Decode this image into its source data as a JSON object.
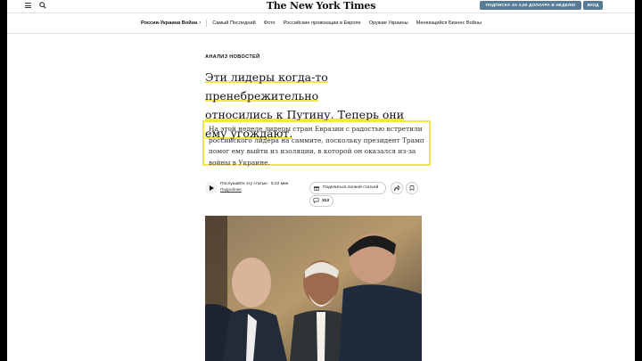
{
  "header": {
    "logo": "The New York Times",
    "subscribe_label": "ПОДПИСКА ЗА 0,50 ДОЛЛАРА В НЕДЕЛЮ",
    "login_label": "ВХОД"
  },
  "nav": {
    "main": "Россия-Украина Война",
    "items": [
      "Самый Последний",
      "Фото",
      "Российские провокации в Европе",
      "Оружие Украины",
      "Меняющийся Бизнес Войны"
    ]
  },
  "article": {
    "kicker": "АНАЛИЗ НОВОСТЕЙ",
    "headline_lines": [
      "Эти лидеры когда-то пренебрежительно",
      "относились к Путину. Теперь они",
      "ему угождают."
    ],
    "summary": "На этой неделе лидеры стран Евразии с радостью встретили российского лидера на саммите, поскольку президент Трамп помог ему выйти из изоляции, в которой он оказался из-за войны в Украине.",
    "listen_label": "Послушайте эту статью · 5:22 мин",
    "listen_more": "Подробнее",
    "share_label": "Поделиться полной статьей",
    "comments_count": "313"
  },
  "colors": {
    "button_bg": "#567b95",
    "highlight": "#f2e64a"
  }
}
